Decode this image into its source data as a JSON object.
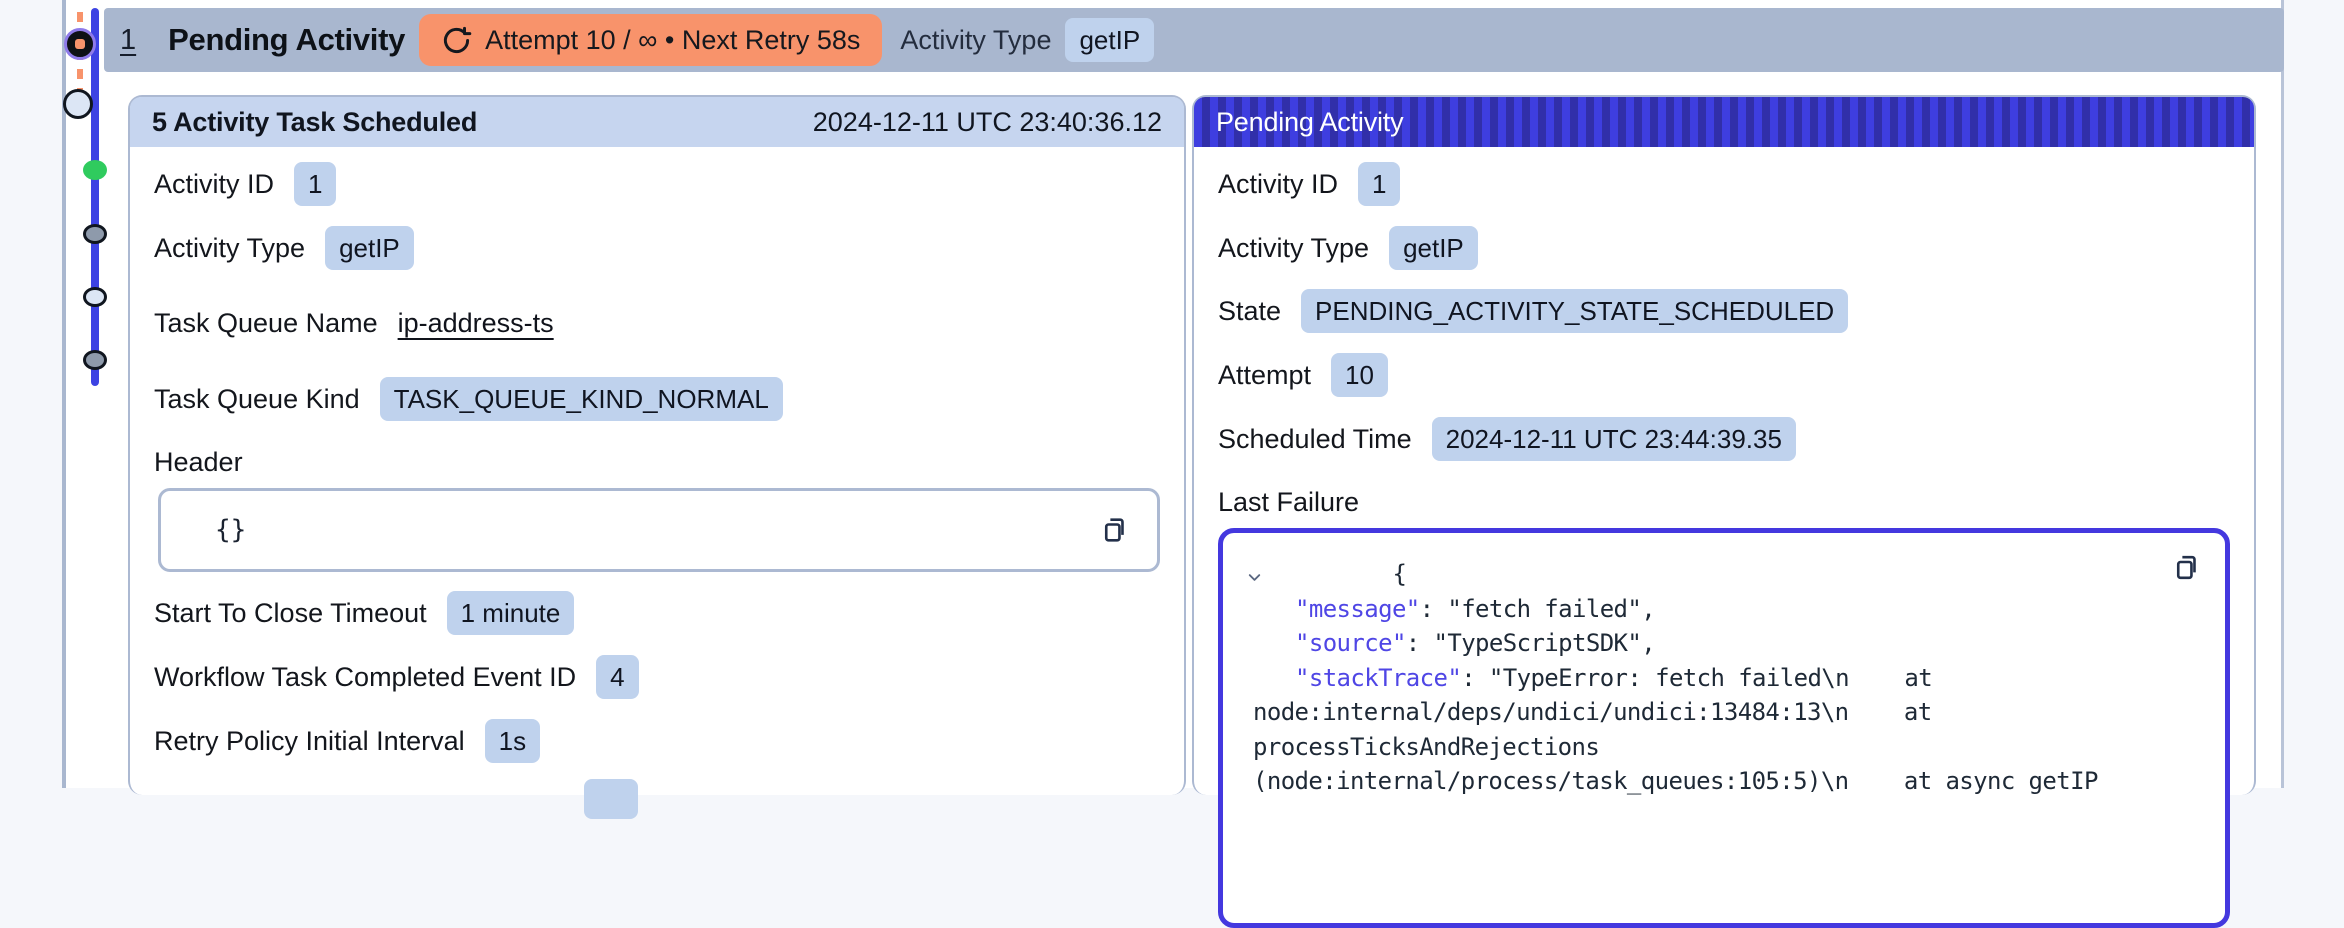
{
  "colors": {
    "app_bg": "#F5F7FB",
    "content_bg": "#FFFFFF",
    "topbar_bg": "#A9B7CF",
    "panel_border": "#ACB9D2",
    "panel_header_bg": "#C6D5EF",
    "badge_bg": "#BFD2ED",
    "orange_badge_bg": "#F8936B",
    "stripe_bright": "#3E3EE0",
    "stripe_dark": "#312FA9",
    "timeline_bar": "#3D43E3",
    "timeline_green": "#2FCB5E",
    "timeline_gray": "#8E9AAB",
    "timeline_light": "#DCE6F5",
    "marker_purple": "#8F7BEA",
    "marker_orange": "#F8936B",
    "code_border": "#4438DF",
    "code_key": "#4F46E5",
    "code_text": "#1E2936",
    "text_dark": "#121722"
  },
  "top_bar": {
    "event_id": "1",
    "title": "Pending Activity",
    "retry_badge": "Attempt 10 / ∞ • Next Retry 58s",
    "activity_type_label": "Activity Type",
    "activity_type_value": "getIP"
  },
  "timeline": {
    "nodes": [
      "current-event-marker",
      "open-circle",
      "green-node",
      "gray-node",
      "light-node",
      "gray-node"
    ]
  },
  "left_panel": {
    "header": {
      "title": "5 Activity Task Scheduled",
      "timestamp": "2024-12-11 UTC 23:40:36.12"
    },
    "fields_top": [
      {
        "label": "Activity ID",
        "value": "1"
      },
      {
        "label": "Activity Type",
        "value": "getIP"
      },
      {
        "label": "Task Queue Name",
        "value": "ip-address-ts"
      },
      {
        "label": "Task Queue Kind",
        "value": "TASK_QUEUE_KIND_NORMAL"
      }
    ],
    "header_section": {
      "label": "Header",
      "code": "{}"
    },
    "fields_bottom": [
      {
        "label": "Start To Close Timeout",
        "value": "1 minute"
      },
      {
        "label": "Workflow Task Completed Event ID",
        "value": "4"
      },
      {
        "label": "Retry Policy Initial Interval",
        "value": "1s"
      }
    ]
  },
  "right_panel": {
    "header": {
      "title": "Pending Activity"
    },
    "fields": [
      {
        "label": "Activity ID",
        "value": "1"
      },
      {
        "label": "Activity Type",
        "value": "getIP"
      },
      {
        "label": "State",
        "value": "PENDING_ACTIVITY_STATE_SCHEDULED"
      },
      {
        "label": "Attempt",
        "value": "10"
      },
      {
        "label": "Scheduled Time",
        "value": "2024-12-11 UTC 23:44:39.35"
      }
    ],
    "last_failure": {
      "label": "Last Failure",
      "lines": [
        {
          "text": "{"
        },
        {
          "key": "\"message\"",
          "sep": ": ",
          "value": "\"fetch failed\","
        },
        {
          "key": "\"source\"",
          "sep": ": ",
          "value": "\"TypeScriptSDK\","
        },
        {
          "key": "\"stackTrace\"",
          "sep": ": ",
          "value": "\"TypeError: fetch failed\\n    at"
        },
        {
          "text": "node:internal/deps/undici/undici:13484:13\\n    at"
        },
        {
          "text": "processTicksAndRejections"
        },
        {
          "text": "(node:internal/process/task_queues:105:5)\\n    at async getIP"
        }
      ]
    }
  }
}
